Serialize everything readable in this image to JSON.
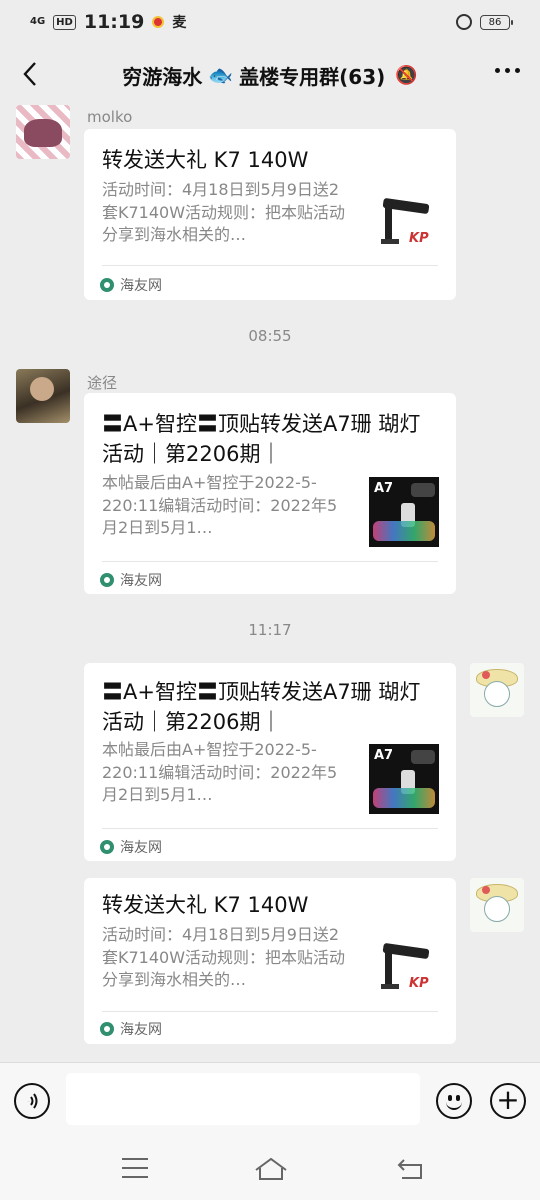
{
  "status_bar": {
    "network": "4G",
    "hd": "HD",
    "time": "11:19",
    "app_icon": "麦",
    "battery": "86"
  },
  "header": {
    "back_label": "‹",
    "title_prefix": "穷游海水",
    "title_emoji": "🐟",
    "title_suffix": "盖楼专用群(63)",
    "mute_icon": "🔕"
  },
  "messages": [
    {
      "sender": "molko",
      "card": {
        "title": "转发送大礼 K7 140W",
        "desc": "活动时间：4月18日到5月9日送2套K7140W活动规则：把本贴活动分享到海水相关的…",
        "source": "海友网",
        "thumb_logo": "KP"
      }
    },
    {
      "timestamp": "08:55",
      "sender": "途径",
      "card": {
        "title": "〓A+智控〓顶贴转发送A7珊 瑚灯活动｜第2206期｜",
        "desc": "本帖最后由A+智控于2022-5-220:11编辑活动时间：2022年5月2日到5月1…",
        "source": "海友网",
        "thumb_label": "A7"
      }
    },
    {
      "timestamp": "11:17",
      "card": {
        "title": "〓A+智控〓顶贴转发送A7珊 瑚灯活动｜第2206期｜",
        "desc": "本帖最后由A+智控于2022-5-220:11编辑活动时间：2022年5月2日到5月1…",
        "source": "海友网",
        "thumb_label": "A7"
      }
    },
    {
      "card": {
        "title": "转发送大礼 K7 140W",
        "desc": "活动时间：4月18日到5月9日送2套K7140W活动规则：把本贴活动分享到海水相关的…",
        "source": "海友网",
        "thumb_logo": "KP"
      }
    }
  ],
  "input_bar": {
    "placeholder": "",
    "voice_icon": "voice-icon",
    "emoji_icon": "emoji-icon",
    "plus_icon": "plus-icon"
  },
  "nav_bar": {
    "menu_icon": "menu-icon",
    "home_icon": "home-icon",
    "back_icon": "back-icon"
  }
}
